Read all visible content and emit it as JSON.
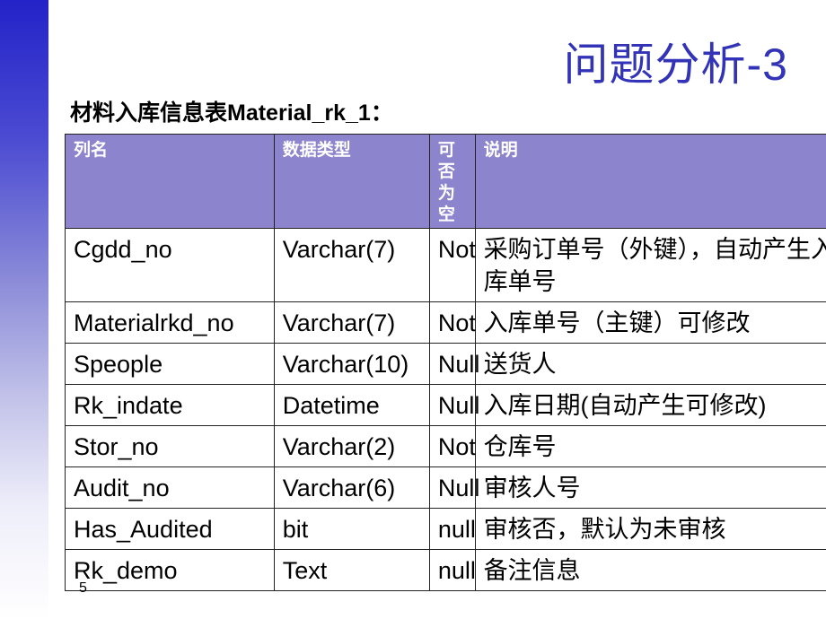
{
  "slide": {
    "title": "问题分析-3",
    "caption": "材料入库信息表Material_rk_1：",
    "page_number": "5",
    "colors": {
      "title": "#3333b8",
      "header_bg": "#8c84cc",
      "header_text": "#ffffff",
      "sidebar_top": "#2323c8"
    }
  },
  "table": {
    "headers": [
      "列名",
      "数据类型",
      "可否为空",
      "说明"
    ],
    "rows": [
      {
        "name": "Cgdd_no",
        "type": "Varchar(7)",
        "nullable": "Not",
        "desc": "采购订单号（外键），自动产生入库单号"
      },
      {
        "name": "Materialrkd_no",
        "type": "Varchar(7)",
        "nullable": "Not",
        "desc": "入库单号（主键）可修改"
      },
      {
        "name": "Speople",
        "type": "Varchar(10)",
        "nullable": "Null",
        "desc": "送货人"
      },
      {
        "name": "Rk_indate",
        "type": "Datetime",
        "nullable": "Null",
        "desc": "入库日期(自动产生可修改)"
      },
      {
        "name": "Stor_no",
        "type": "Varchar(2)",
        "nullable": "Not",
        "desc": "仓库号"
      },
      {
        "name": "Audit_no",
        "type": "Varchar(6)",
        "nullable": "Null",
        "desc": "审核人号"
      },
      {
        "name": "Has_Audited",
        "type": "bit",
        "nullable": "null",
        "desc": "审核否，默认为未审核"
      },
      {
        "name": "Rk_demo",
        "type": "Text",
        "nullable": "null",
        "desc": "备注信息"
      }
    ]
  }
}
